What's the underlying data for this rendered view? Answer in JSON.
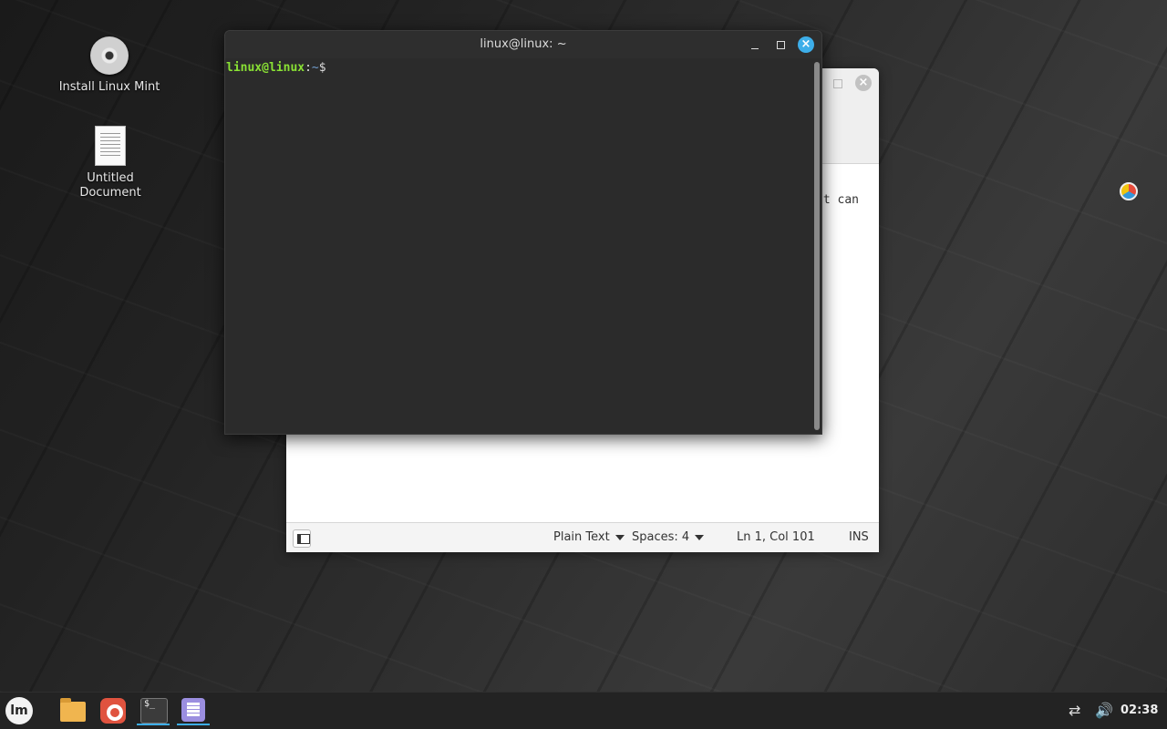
{
  "desktop": {
    "icons": [
      {
        "label": "Install Linux Mint",
        "icon": "disc-icon"
      },
      {
        "label": "Untitled Document",
        "icon": "text-document-icon"
      }
    ]
  },
  "editor": {
    "visible_text": "t can",
    "status": {
      "language": "Plain Text",
      "spaces": "Spaces: 4",
      "position": "Ln 1, Col 101",
      "mode": "INS"
    }
  },
  "terminal": {
    "title": "linux@linux: ~",
    "prompt_user": "linux@linux",
    "prompt_sep": ":",
    "prompt_path": "~",
    "prompt_symbol": "$"
  },
  "panel": {
    "clock": "02:38",
    "accent": "#3daee9"
  }
}
